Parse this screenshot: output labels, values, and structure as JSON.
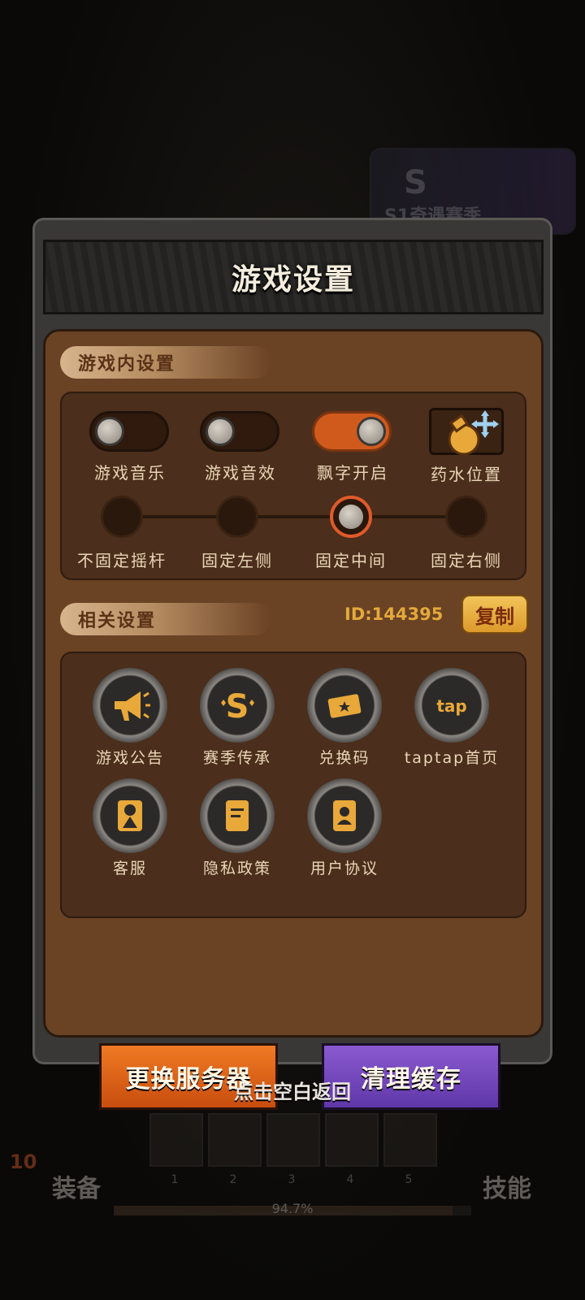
{
  "background": {
    "season_banner": "S1奇遇赛季"
  },
  "dialog": {
    "title": "游戏设置",
    "in_game_section": {
      "heading": "游戏内设置",
      "toggles": [
        {
          "label": "游戏音乐",
          "on": false
        },
        {
          "label": "游戏音效",
          "on": false
        },
        {
          "label": "飘字开启",
          "on": true
        }
      ],
      "potion_position_label": "药水位置",
      "joystick_options": [
        {
          "label": "不固定摇杆",
          "selected": false
        },
        {
          "label": "固定左侧",
          "selected": false
        },
        {
          "label": "固定中间",
          "selected": true
        },
        {
          "label": "固定右侧",
          "selected": false
        }
      ]
    },
    "related_section": {
      "heading": "相关设置",
      "player_id": "ID:144395",
      "copy_label": "复制",
      "items": [
        {
          "label": "游戏公告",
          "icon": "megaphone-icon"
        },
        {
          "label": "赛季传承",
          "icon": "season-s-icon"
        },
        {
          "label": "兑换码",
          "icon": "ticket-icon"
        },
        {
          "label": "taptap首页",
          "icon": "taptap-icon"
        },
        {
          "label": "客服",
          "icon": "customer-service-icon"
        },
        {
          "label": "隐私政策",
          "icon": "document-icon"
        },
        {
          "label": "用户协议",
          "icon": "user-card-icon"
        }
      ]
    },
    "change_server_label": "更换服务器",
    "clear_cache_label": "清理缓存"
  },
  "tap_hint": "点击空白返回",
  "hud": {
    "level": "10",
    "equip_label": "装备",
    "skill_label": "技能",
    "slot_numbers": [
      "1",
      "2",
      "3",
      "4",
      "5"
    ],
    "progress_text": "94.7%",
    "progress_value": 0.947
  },
  "colors": {
    "toggle_on": "#d05a1c",
    "accent_gold": "#e3a93b",
    "button_orange": "#e06a1a",
    "button_purple": "#7a4cc0",
    "panel_brown": "#6a4224"
  }
}
